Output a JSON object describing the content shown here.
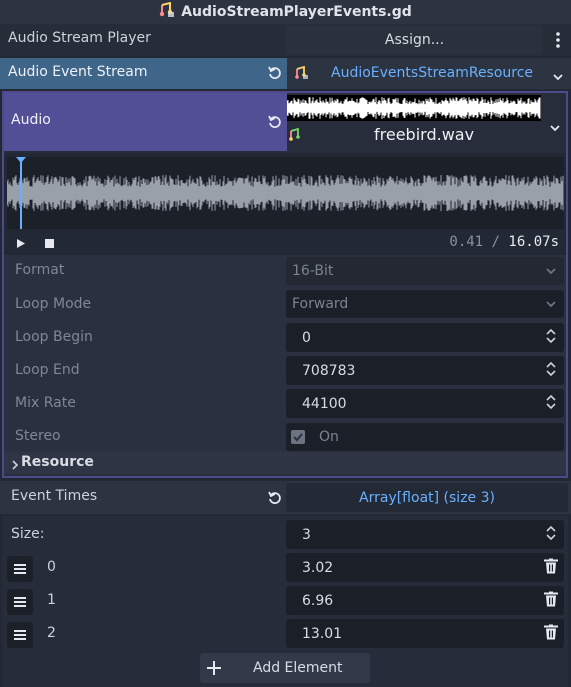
{
  "header": {
    "title": "AudioStreamPlayerEvents.gd",
    "icon": "audio-script-icon"
  },
  "audio_stream_player": {
    "label": "Audio Stream Player",
    "button": "Assign..."
  },
  "audio_event_stream": {
    "label": "Audio Event Stream",
    "resource": "AudioEventsStreamResource"
  },
  "audio": {
    "label": "Audio",
    "file": "freebird.wav",
    "playback": {
      "current": "0.41",
      "separator": "/",
      "total": "16.07s"
    },
    "properties": {
      "format": {
        "label": "Format",
        "value": "16-Bit"
      },
      "loop_mode": {
        "label": "Loop Mode",
        "value": "Forward"
      },
      "loop_begin": {
        "label": "Loop Begin",
        "value": "0"
      },
      "loop_end": {
        "label": "Loop End",
        "value": "708783"
      },
      "mix_rate": {
        "label": "Mix Rate",
        "value": "44100"
      },
      "stereo": {
        "label": "Stereo",
        "value": "On",
        "checked": true
      }
    },
    "resource_section": "Resource"
  },
  "event_times": {
    "label": "Event Times",
    "array_type": "Array[float] (size 3)",
    "size_label": "Size:",
    "size_value": "3",
    "items": [
      {
        "index": "0",
        "value": "3.02"
      },
      {
        "index": "1",
        "value": "6.96"
      },
      {
        "index": "2",
        "value": "13.01"
      }
    ],
    "add_button": "Add Element"
  },
  "colors": {
    "background": "#222834",
    "highlight_row": "#36506d",
    "audio_accent": "#524f96",
    "link_blue": "#6ab0ff"
  }
}
